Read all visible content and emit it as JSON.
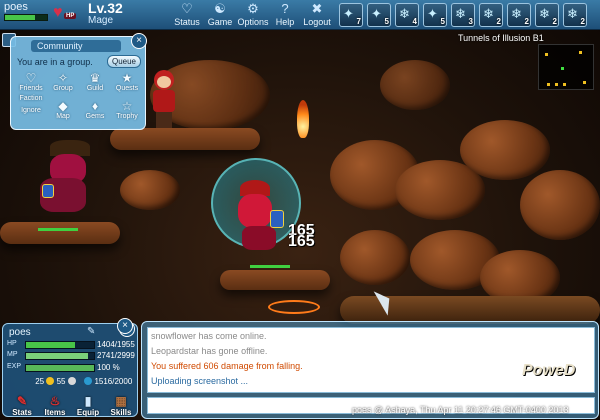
{
  "player": {
    "name": "poes",
    "level": "Lv.32",
    "class": "Mage",
    "hp_tag": "HP"
  },
  "menu": {
    "status": "Status",
    "game": "Game",
    "options": "Options",
    "help": "Help",
    "logout": "Logout"
  },
  "skills": [
    "7",
    "5",
    "4",
    "5",
    "3",
    "2",
    "2",
    "2",
    "2"
  ],
  "community": {
    "title": "Community",
    "group_status": "You are in a group.",
    "queue": "Queue",
    "items": [
      "Friends",
      "Group",
      "Guild",
      "Quests",
      "Faction",
      "Map",
      "Gems",
      "Trophy"
    ],
    "ignore": "Ignore"
  },
  "map": {
    "name": "Tunnels of Illusion B1"
  },
  "damage": [
    "165",
    "165"
  ],
  "stats": {
    "name": "poes",
    "hp_label": "HP",
    "mp_label": "MP",
    "exp_label": "EXP",
    "hp": "1404/1955",
    "hp_fraction": 0.718,
    "mp": "2741/2999",
    "mp_fraction": 0.914,
    "exp": "100 %",
    "exp_fraction": 1.0,
    "gold": "25",
    "silver": "55",
    "weight": "1516/2000",
    "buttons": [
      "Stats",
      "Items",
      "Equip",
      "Skills"
    ]
  },
  "chat": {
    "lines": [
      {
        "text": "snowflower has come online.",
        "color": "#8a8a8a"
      },
      {
        "text": "Leopardstar has gone offline.",
        "color": "#8a8a8a"
      },
      {
        "text": "You suffered 606 damage from falling.",
        "color": "#d04a00"
      },
      {
        "text": "Uploading screenshot ...",
        "color": "#2a6aa0"
      }
    ]
  },
  "footer": {
    "timestamp": "poes @ Ashaya, Thu Apr 11 20:27:46 GMT-0400 2013",
    "logo": "PoweD"
  },
  "colors": {
    "hp": "#48c548",
    "mp": "#7ad07a",
    "exp": "#58b858",
    "bar_bg": "#1e4f78"
  }
}
